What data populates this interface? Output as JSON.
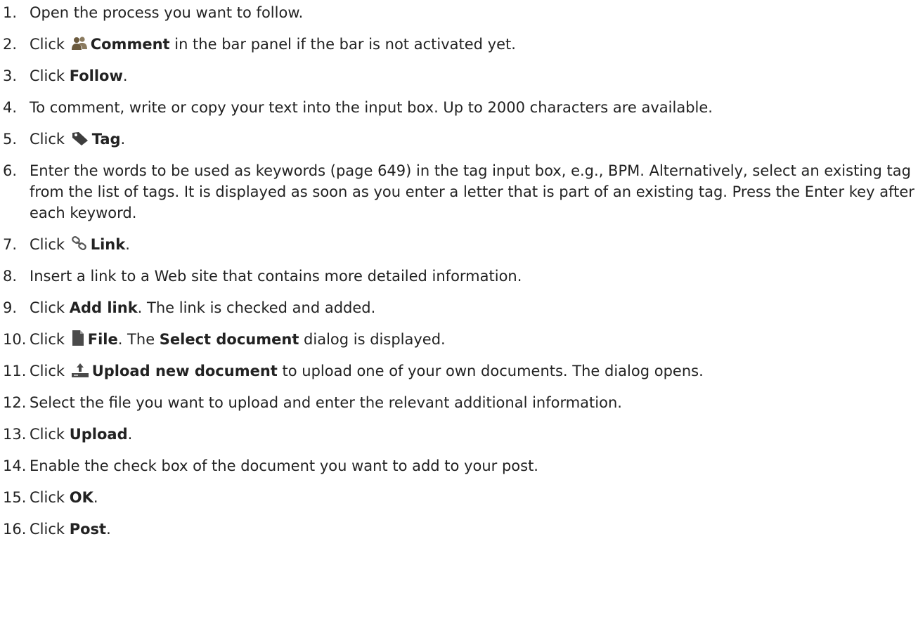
{
  "steps": [
    {
      "num": "1.",
      "parts": [
        {
          "t": "Open the process you want to follow."
        }
      ]
    },
    {
      "num": "2.",
      "parts": [
        {
          "t": "Click "
        },
        {
          "icon": "users-icon"
        },
        {
          "t": "Comment",
          "b": true
        },
        {
          "t": " in the bar panel if the bar is not activated yet."
        }
      ]
    },
    {
      "num": "3.",
      "parts": [
        {
          "t": "Click "
        },
        {
          "t": "Follow",
          "b": true
        },
        {
          "t": "."
        }
      ]
    },
    {
      "num": "4.",
      "parts": [
        {
          "t": "To comment, write or copy your text into the input box. Up to 2000 characters are available."
        }
      ]
    },
    {
      "num": "5.",
      "parts": [
        {
          "t": "Click "
        },
        {
          "icon": "tag-icon"
        },
        {
          "t": "Tag",
          "b": true
        },
        {
          "t": "."
        }
      ]
    },
    {
      "num": "6.",
      "multi": true,
      "parts": [
        {
          "t": "Enter the words to be used as keywords (page 649) in the tag input box, e.g., BPM. Alternatively, select an existing tag from the list of tags. It is displayed as soon as you enter a letter that is part of an existing tag. Press the Enter key after each keyword."
        }
      ]
    },
    {
      "num": "7.",
      "parts": [
        {
          "t": "Click "
        },
        {
          "icon": "link-icon"
        },
        {
          "t": "Link",
          "b": true
        },
        {
          "t": "."
        }
      ]
    },
    {
      "num": "8.",
      "parts": [
        {
          "t": "Insert a link to a Web site that contains more detailed information."
        }
      ]
    },
    {
      "num": "9.",
      "parts": [
        {
          "t": "Click "
        },
        {
          "t": "Add link",
          "b": true
        },
        {
          "t": ". The link is checked and added."
        }
      ]
    },
    {
      "num": "10.",
      "parts": [
        {
          "t": "Click "
        },
        {
          "icon": "file-icon"
        },
        {
          "t": "File",
          "b": true
        },
        {
          "t": ". The "
        },
        {
          "t": "Select document",
          "b": true
        },
        {
          "t": " dialog is displayed."
        }
      ]
    },
    {
      "num": "11.",
      "parts": [
        {
          "t": "Click "
        },
        {
          "icon": "upload-icon"
        },
        {
          "t": "Upload new document",
          "b": true
        },
        {
          "t": " to upload one of your own documents. The dialog opens."
        }
      ]
    },
    {
      "num": "12.",
      "parts": [
        {
          "t": "Select the file you want to upload and enter the relevant additional information."
        }
      ]
    },
    {
      "num": "13.",
      "parts": [
        {
          "t": "Click "
        },
        {
          "t": "Upload",
          "b": true
        },
        {
          "t": "."
        }
      ]
    },
    {
      "num": "14.",
      "parts": [
        {
          "t": "Enable the check box of the document you want to add to your post."
        }
      ]
    },
    {
      "num": "15.",
      "parts": [
        {
          "t": "Click "
        },
        {
          "t": "OK",
          "b": true
        },
        {
          "t": "."
        }
      ]
    },
    {
      "num": "16.",
      "parts": [
        {
          "t": "Click "
        },
        {
          "t": "Post",
          "b": true
        },
        {
          "t": "."
        }
      ]
    }
  ]
}
